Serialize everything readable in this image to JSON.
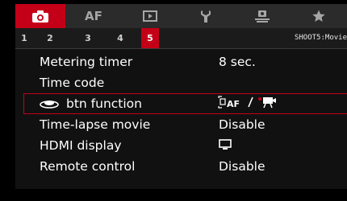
{
  "tabs": [
    {
      "id": "shooting",
      "label": "",
      "icon": "camera-icon",
      "active": true
    },
    {
      "id": "af",
      "label": "AF",
      "icon": "",
      "active": false
    },
    {
      "id": "playback",
      "label": "",
      "icon": "playback-icon",
      "active": false
    },
    {
      "id": "setup",
      "label": "",
      "icon": "wrench-icon",
      "active": false
    },
    {
      "id": "custom",
      "label": "",
      "icon": "custom-function-icon",
      "active": false
    },
    {
      "id": "mymenu",
      "label": "",
      "icon": "star-icon",
      "active": false
    }
  ],
  "subtabs": [
    "1",
    "2",
    "3",
    "4",
    "5"
  ],
  "active_subtab": "5",
  "menu_title": "SHOOT5:Movie",
  "items": [
    {
      "label": "Metering timer",
      "value": "8 sec."
    },
    {
      "label": "Time code",
      "value": ""
    },
    {
      "label": "btn function",
      "label_icon": "shutter-button-icon",
      "value_icons": [
        "af-icon",
        "movie-record-icon"
      ],
      "selected": true
    },
    {
      "label": "Time-lapse movie",
      "value": "Disable"
    },
    {
      "label": "HDMI display",
      "value_icons": [
        "monitor-icon"
      ]
    },
    {
      "label": "Remote control",
      "value": "Disable"
    }
  ],
  "colors": {
    "accent": "#c40018",
    "background": "#111111",
    "tabbar": "#2b2b2b"
  }
}
